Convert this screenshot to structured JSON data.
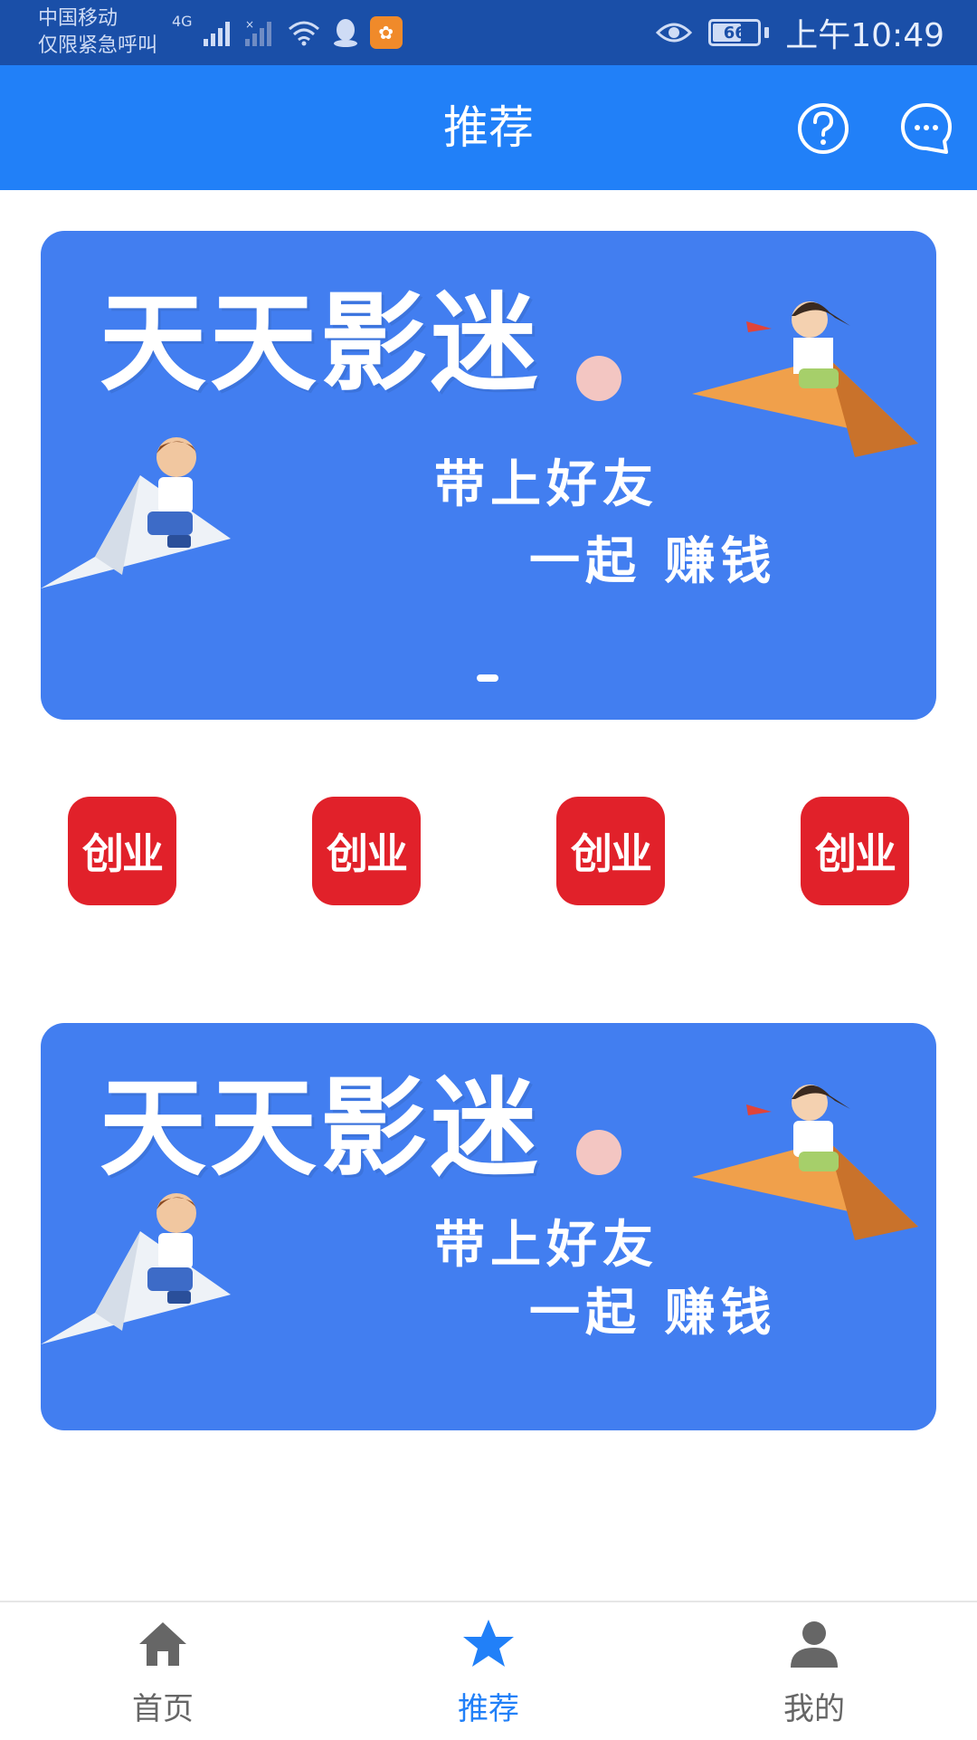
{
  "status_bar": {
    "carrier_line1": "中国移动",
    "carrier_line2": "仅限紧急呼叫",
    "network": "4G",
    "battery": "66",
    "time": "上午10:49",
    "icons": [
      "signal-icon",
      "no-signal-icon",
      "wifi-icon",
      "qq-icon",
      "uc-browser-icon",
      "eye-icon",
      "battery-icon"
    ]
  },
  "header": {
    "title": "推荐",
    "help_icon": "question-circle-icon",
    "message_icon": "chat-bubble-icon"
  },
  "banners": [
    {
      "title": "天天影迷",
      "slogan_line1": "带上好友",
      "slogan_line2": "一起 赚钱"
    },
    {
      "title": "天天影迷",
      "slogan_line1": "带上好友",
      "slogan_line2": "一起 赚钱"
    }
  ],
  "apps": [
    {
      "label": "创业",
      "color": "#e1212a"
    },
    {
      "label": "创业",
      "color": "#e1212a"
    },
    {
      "label": "创业",
      "color": "#e1212a"
    },
    {
      "label": "创业",
      "color": "#e1212a"
    }
  ],
  "bottom_nav": {
    "items": [
      {
        "label": "首页",
        "icon": "home-icon",
        "active": false
      },
      {
        "label": "推荐",
        "icon": "star-icon",
        "active": true
      },
      {
        "label": "我的",
        "icon": "user-icon",
        "active": false
      }
    ]
  },
  "colors": {
    "primary": "#2180f8",
    "status_bar": "#1a4fa8",
    "banner": "#427ef0",
    "app_icon": "#e1212a",
    "nav_inactive": "#666666"
  }
}
